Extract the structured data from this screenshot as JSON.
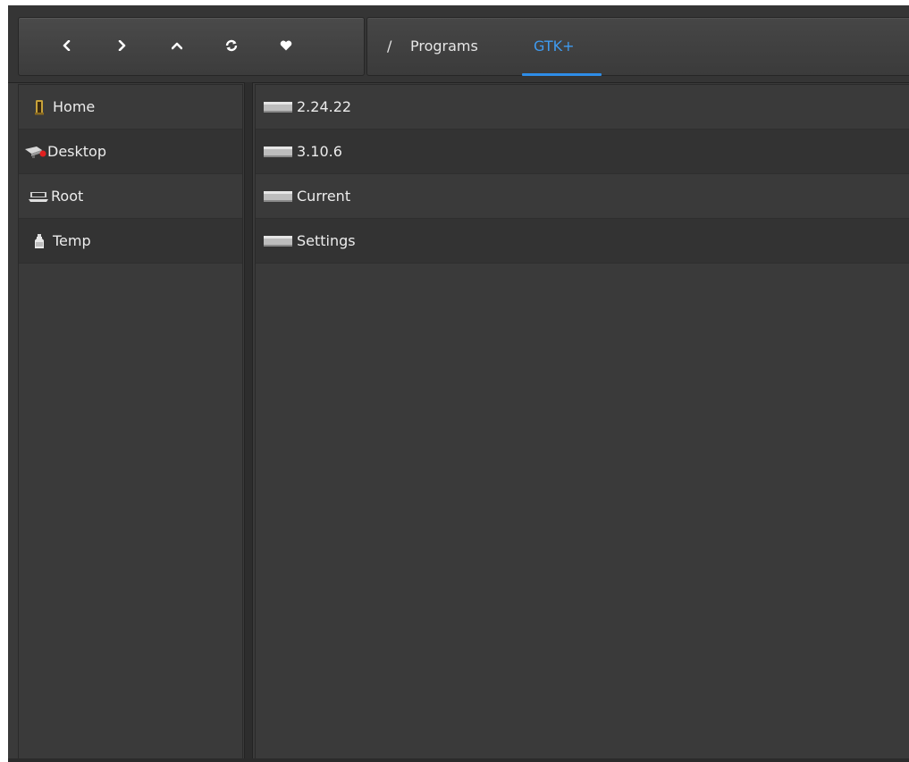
{
  "toolbar": {
    "buttons": [
      {
        "icon": "chevron-left-icon"
      },
      {
        "icon": "chevron-right-icon"
      },
      {
        "icon": "chevron-up-icon"
      },
      {
        "icon": "refresh-icon"
      },
      {
        "icon": "heart-icon"
      }
    ]
  },
  "breadcrumb": {
    "root": "/",
    "items": [
      "Programs",
      "GTK+"
    ],
    "active_index": 1,
    "active_color": "#3f9bf0"
  },
  "sidebar": {
    "items": [
      {
        "label": "Home",
        "icon": "home-icon"
      },
      {
        "label": "Desktop",
        "icon": "desktop-icon"
      },
      {
        "label": "Root",
        "icon": "drive-icon"
      },
      {
        "label": "Temp",
        "icon": "bottle-icon"
      }
    ]
  },
  "files": {
    "items": [
      {
        "name": "2.24.22",
        "icon": "folder-icon"
      },
      {
        "name": "3.10.6",
        "icon": "folder-icon"
      },
      {
        "name": "Current",
        "icon": "folder-icon"
      },
      {
        "name": "Settings",
        "icon": "folder-icon"
      }
    ]
  },
  "theme": {
    "background": "#3a3a3a",
    "accent": "#2e8de8"
  }
}
